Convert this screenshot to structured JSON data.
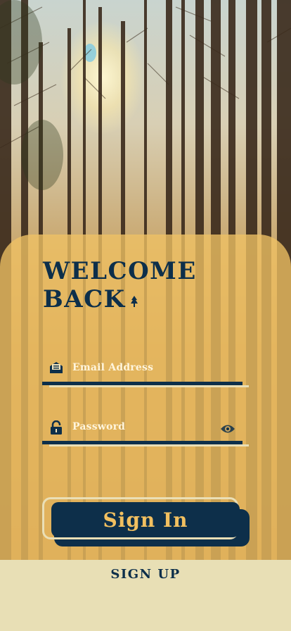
{
  "login": {
    "title_line1": "WELCOME",
    "title_line2": "BACK",
    "email_placeholder": "Email Address",
    "password_placeholder": "Password",
    "sign_in_label": "Sign In",
    "sign_up_label": "SIGN UP"
  },
  "icons": {
    "title": "tree-icon",
    "email": "mail-icon",
    "password": "lock-icon",
    "visibility": "eye-icon"
  },
  "colors": {
    "navy": "#0d2f4a",
    "gold": "#f2c060",
    "cream": "#eadfb6",
    "card_overlay": "#f0c264"
  }
}
